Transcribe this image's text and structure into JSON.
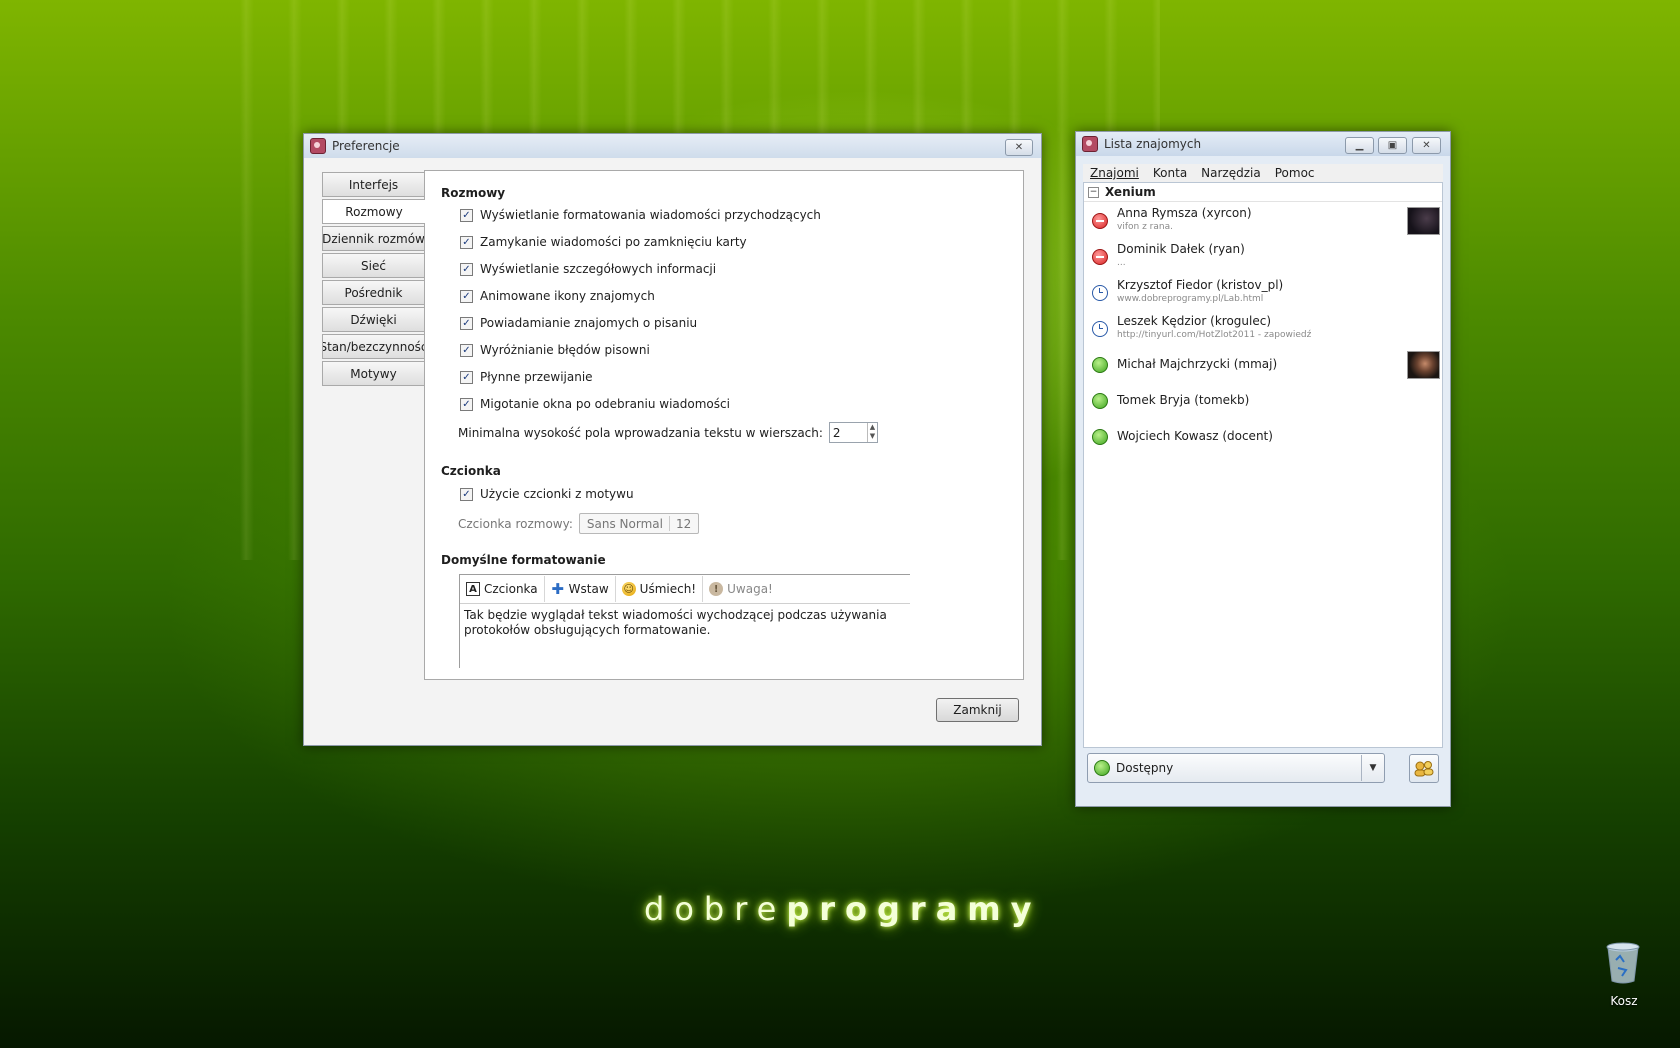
{
  "prefs": {
    "title": "Preferencje",
    "close_glyph": "✕",
    "tabs": [
      "Interfejs",
      "Rozmowy",
      "Dziennik rozmów",
      "Sieć",
      "Pośrednik",
      "Dźwięki",
      "Stan/bezczynność",
      "Motywy"
    ],
    "active_tab_index": 1,
    "section_conversations": "Rozmowy",
    "checkboxes": [
      {
        "label": "Wyświetlanie formatowania wiadomości przychodzących",
        "checked": true
      },
      {
        "label": "Zamykanie wiadomości po zamknięciu karty",
        "checked": true
      },
      {
        "label": "Wyświetlanie szczegółowych informacji",
        "checked": true
      },
      {
        "label": "Animowane ikony znajomych",
        "checked": true
      },
      {
        "label": "Powiadamianie znajomych o pisaniu",
        "checked": true
      },
      {
        "label": "Wyróżnianie błędów pisowni",
        "checked": true
      },
      {
        "label": "Płynne przewijanie",
        "checked": true
      },
      {
        "label": "Migotanie okna po odebraniu wiadomości",
        "checked": true
      }
    ],
    "min_height_label": "Minimalna wysokość pola wprowadzania tekstu w wierszach:",
    "min_height_value": "2",
    "section_font": "Czcionka",
    "use_theme_font": {
      "label": "Użycie czcionki z motywu",
      "checked": true
    },
    "conv_font_label": "Czcionka rozmowy:",
    "conv_font_name": "Sans Normal",
    "conv_font_size": "12",
    "section_default_format": "Domyślne formatowanie",
    "format_toolbar": {
      "font": "Czcionka",
      "insert": "Wstaw",
      "smile": "Uśmiech!",
      "attention": "Uwaga!"
    },
    "format_preview": "Tak będzie wyglądał tekst wiadomości wychodzącej podczas używania protokołów obsługujących formatowanie.",
    "close_button": "Zamknij"
  },
  "buddy": {
    "title": "Lista znajomych",
    "menu": [
      "Znajomi",
      "Konta",
      "Narzędzia",
      "Pomoc"
    ],
    "group": "Xenium",
    "contacts": [
      {
        "name": "Anna Rymsza (xyrcon)",
        "status": "busy",
        "message": "vifon z rana.",
        "avatar": true
      },
      {
        "name": "Dominik Dałek (ryan)",
        "status": "busy",
        "message": "...",
        "avatar": false
      },
      {
        "name": "Krzysztof Fiedor (kristov_pl)",
        "status": "away",
        "message": "www.dobreprogramy.pl/Lab.html",
        "avatar": false
      },
      {
        "name": "Leszek Kędzior (krogulec)",
        "status": "away",
        "message": "http://tinyurl.com/HotZlot2011 - zapowiedź",
        "avatar": false
      },
      {
        "name": "Michał Majchrzycki (mmaj)",
        "status": "available",
        "message": "",
        "avatar": true
      },
      {
        "name": "Tomek Bryja (tomekb)",
        "status": "available",
        "message": "",
        "avatar": false
      },
      {
        "name": "Wojciech Kowasz (docent)",
        "status": "available",
        "message": "",
        "avatar": false
      }
    ],
    "status_selector": "Dostępny"
  },
  "desktop": {
    "logo_light": "dobre",
    "logo_bold": "programy",
    "trash_label": "Kosz"
  },
  "colors": {
    "busy": "#d92424",
    "away": "#2a5aa8",
    "available": "#3fa620"
  }
}
